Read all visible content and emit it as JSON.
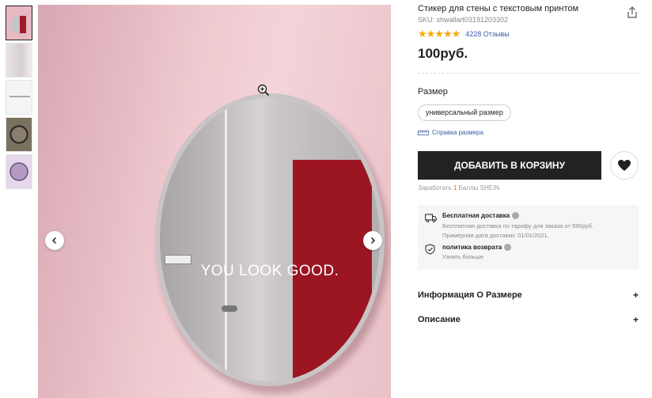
{
  "gallery": {
    "thumbnails": [
      "thumb-1",
      "thumb-2",
      "thumb-3",
      "thumb-4",
      "thumb-5"
    ],
    "main_image_text": "YOU LOOK GOOD."
  },
  "product": {
    "title": "Стикер для стены с текстовым принтом",
    "sku": "SKU: shwallart03191203302",
    "rating_stars": "★★★★★",
    "reviews": "4228 Отзывы",
    "price": "100руб."
  },
  "size": {
    "label": "Размер",
    "option": "универсальный размер",
    "guide": "Справка размера"
  },
  "actions": {
    "add_to_cart": "ДОБАВИТЬ В КОРЗИНУ",
    "earn_prefix": "Заработать",
    "earn_points": "1",
    "earn_suffix": "Баллы SHEIN"
  },
  "shipping": {
    "free_title": "Бесплатная доставка",
    "free_line1": "Бесплатная доставка по тарифу для заказа от 590руб.",
    "free_line2": "Примерная дата доставки: 01/01/2021.",
    "return_title": "политика возврата",
    "return_sub": "Узнать больше"
  },
  "accordion": {
    "size_info": "Информация О Размере",
    "description": "Описание",
    "plus": "+"
  },
  "colors": {
    "accent_blue": "#3a5ba8",
    "star": "#f7a707",
    "button_dark": "#222222",
    "points_orange": "#e86b1c"
  }
}
